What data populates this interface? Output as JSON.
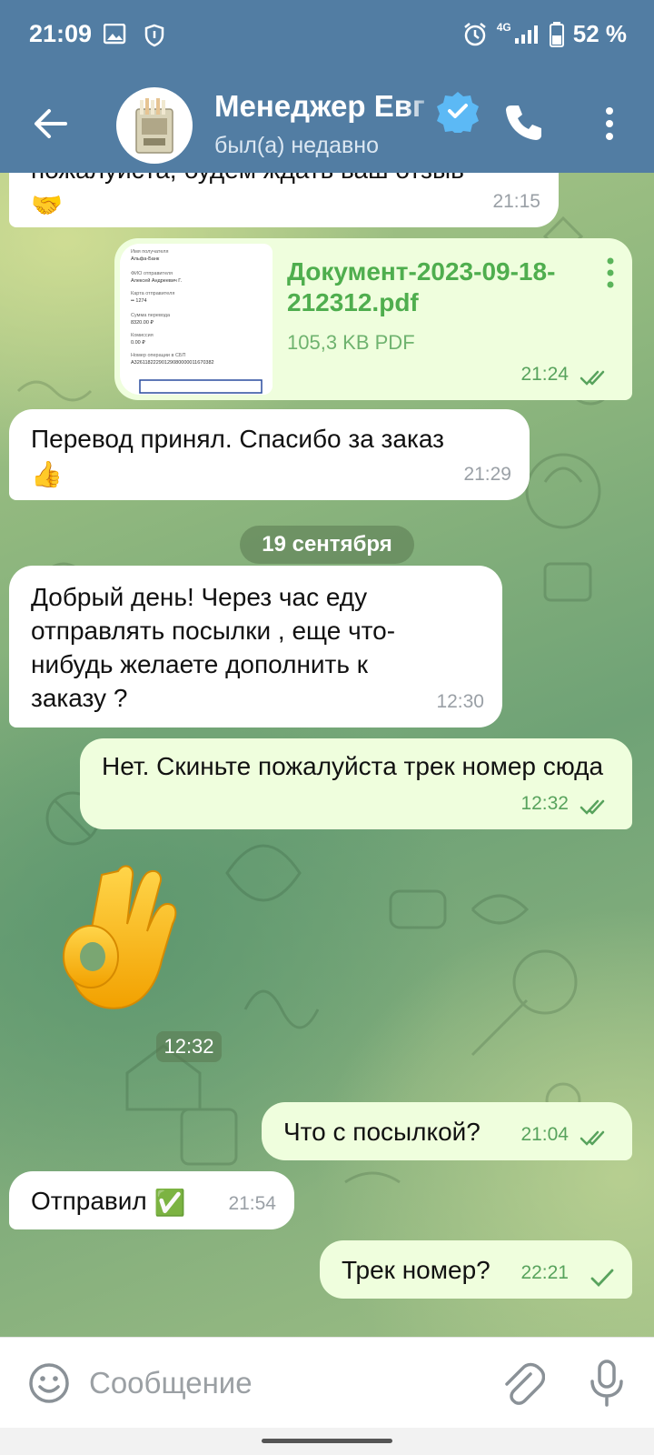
{
  "status_bar": {
    "time": "21:09",
    "network": "4G",
    "battery": "52 %",
    "icons": [
      "gallery-icon",
      "shield-icon",
      "alarm-icon",
      "signal-icon",
      "battery-icon"
    ]
  },
  "header": {
    "title": "Менеджер Евг",
    "subtitle": "был(а) недавно",
    "verified": true,
    "icons": [
      "back-arrow-icon",
      "verified-badge-icon",
      "phone-icon",
      "more-vertical-icon"
    ]
  },
  "messages": [
    {
      "id": "m1",
      "direction": "in",
      "text": "пожалуйста, будем ждать ваш отзыв",
      "emoji": "🤝",
      "time": "21:15"
    },
    {
      "id": "m2",
      "direction": "out",
      "type": "document",
      "file_name": "Документ-2023-09-18-212312.pdf",
      "file_info": "105,3 KB PDF",
      "time": "21:24",
      "status": "read",
      "preview_lines": [
        "Имя получателя",
        "Альфа-Банк",
        "ФИО отправителя",
        "Алексей Андреевич Г.",
        "Карта отправителя",
        "•• 1274",
        "Сумма перевода",
        "8320.00 ₽",
        "Комиссия",
        "0.00 ₽",
        "Номер операции в СБП",
        "A32611822290129080000011670382"
      ]
    },
    {
      "id": "m3",
      "direction": "in",
      "text": "Перевод принял. Спасибо за заказ",
      "emoji": "👍",
      "time": "21:29"
    },
    {
      "id": "m4",
      "direction": "in",
      "text": "Добрый день! Через час еду отправлять посылки , еще что-нибудь желаете дополнить к заказу ?",
      "time": "12:30"
    },
    {
      "id": "m5",
      "direction": "out",
      "text": "Нет. Скиньте пожалуйста трек номер сюда",
      "time": "12:32",
      "status": "read"
    },
    {
      "id": "m6",
      "direction": "out",
      "type": "sticker",
      "sticker": "ok-hand",
      "time": "12:32"
    },
    {
      "id": "m7",
      "direction": "out",
      "text": "Что с посылкой?",
      "time": "21:04",
      "status": "read"
    },
    {
      "id": "m8",
      "direction": "in",
      "text": "Отправил",
      "emoji": "✅",
      "time": "21:54"
    },
    {
      "id": "m9",
      "direction": "out",
      "text": "Трек номер?",
      "time": "22:21",
      "status": "sent"
    }
  ],
  "date_separator": "19 сентября",
  "composer": {
    "placeholder": "Сообщение",
    "icons": [
      "emoji-icon",
      "attach-icon",
      "microphone-icon"
    ]
  },
  "colors": {
    "header": "#527da3",
    "outgoing_bubble": "#effedd",
    "incoming_bubble": "#ffffff",
    "read_ticks": "#58a35d"
  }
}
